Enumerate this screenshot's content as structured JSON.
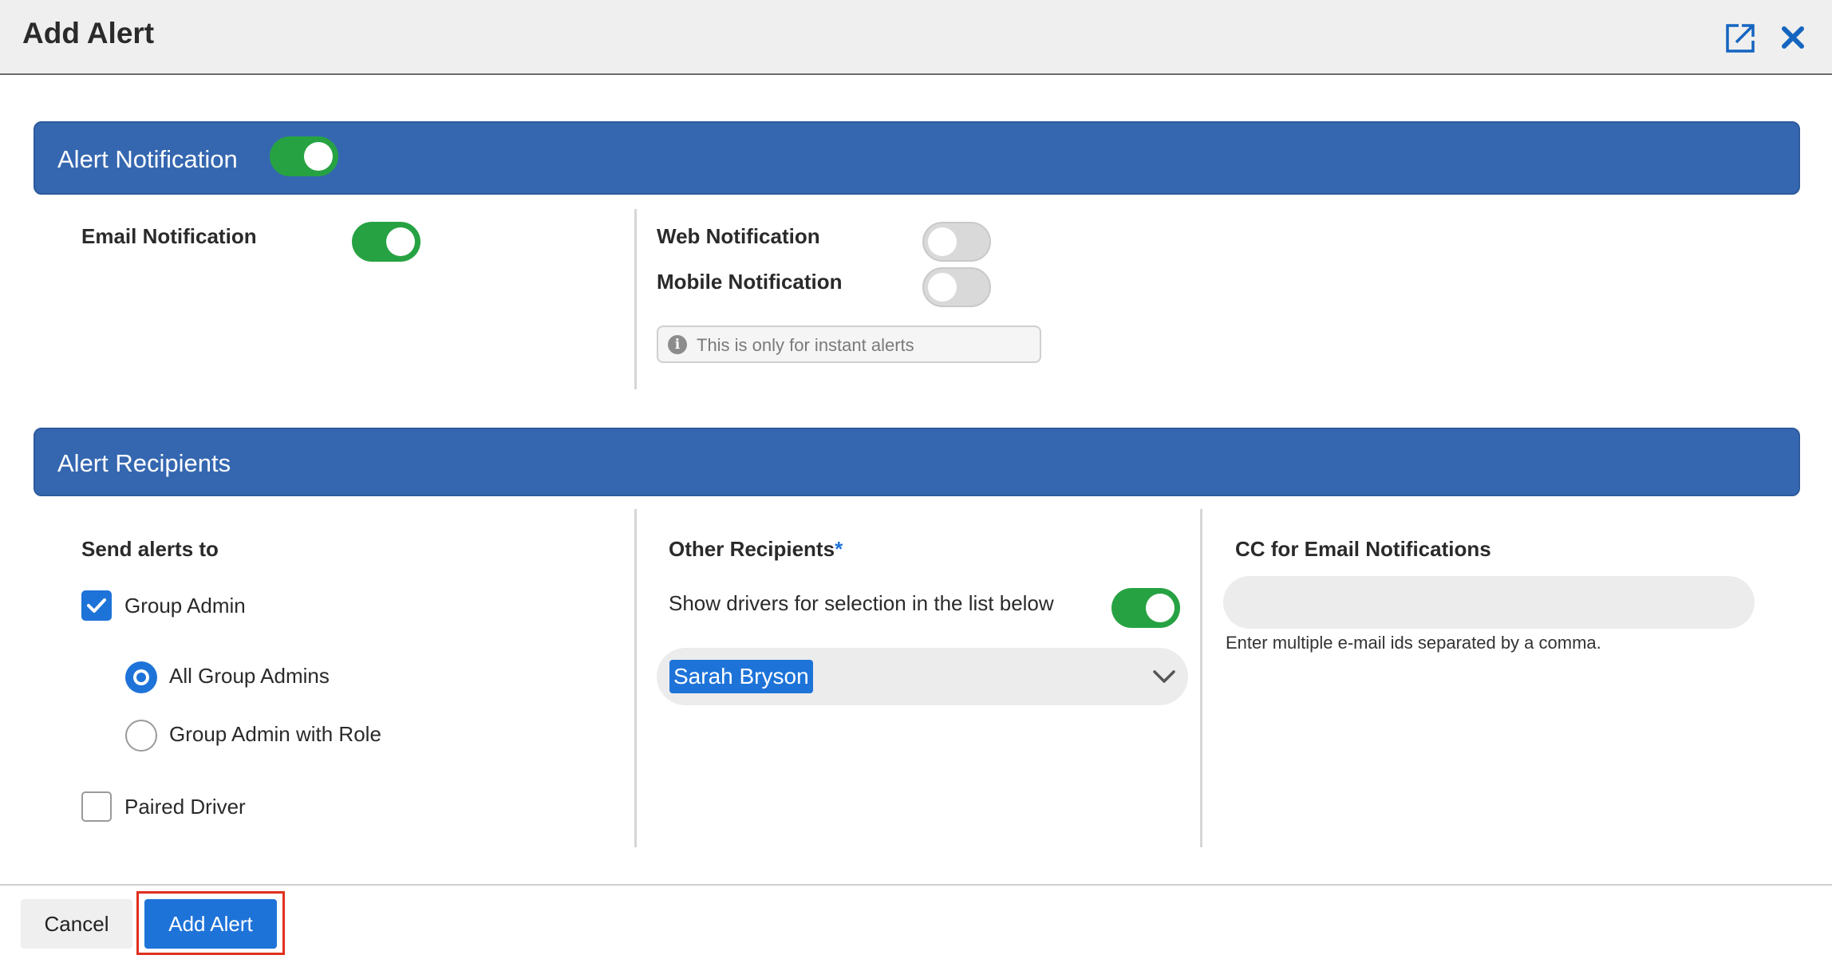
{
  "dialog": {
    "title": "Add Alert",
    "expand_icon": "expand-icon",
    "close_icon": "close-icon"
  },
  "alert_notification": {
    "section_title": "Alert Notification",
    "enabled": true,
    "email": {
      "label": "Email Notification",
      "enabled": true
    },
    "web": {
      "label": "Web Notification",
      "enabled": false
    },
    "mobile": {
      "label": "Mobile Notification",
      "enabled": false
    },
    "info_text": "This is only for instant alerts",
    "info_icon": "info-icon"
  },
  "alert_recipients": {
    "section_title": "Alert Recipients",
    "send_alerts_to": {
      "heading": "Send alerts to",
      "group_admin": {
        "label": "Group Admin",
        "checked": true
      },
      "all_group_admins": {
        "label": "All Group Admins",
        "selected": true
      },
      "group_admin_with_role": {
        "label": "Group Admin with Role",
        "selected": false
      },
      "paired_driver": {
        "label": "Paired Driver",
        "checked": false
      }
    },
    "other_recipients": {
      "heading": "Other Recipients",
      "required_marker": "*",
      "show_drivers_label": "Show drivers for selection in the list below",
      "show_drivers_enabled": true,
      "selected_value": "Sarah Bryson"
    },
    "cc": {
      "heading": "CC for Email Notifications",
      "value": "",
      "placeholder": "",
      "hint": "Enter multiple e-mail ids separated by a comma."
    }
  },
  "footer": {
    "cancel_label": "Cancel",
    "add_label": "Add Alert"
  },
  "colors": {
    "section_bar": "#3567b0",
    "toggle_on": "#27a243",
    "toggle_off": "#d9d9d9",
    "primary": "#1e73d8",
    "highlight": "#e0301e"
  }
}
